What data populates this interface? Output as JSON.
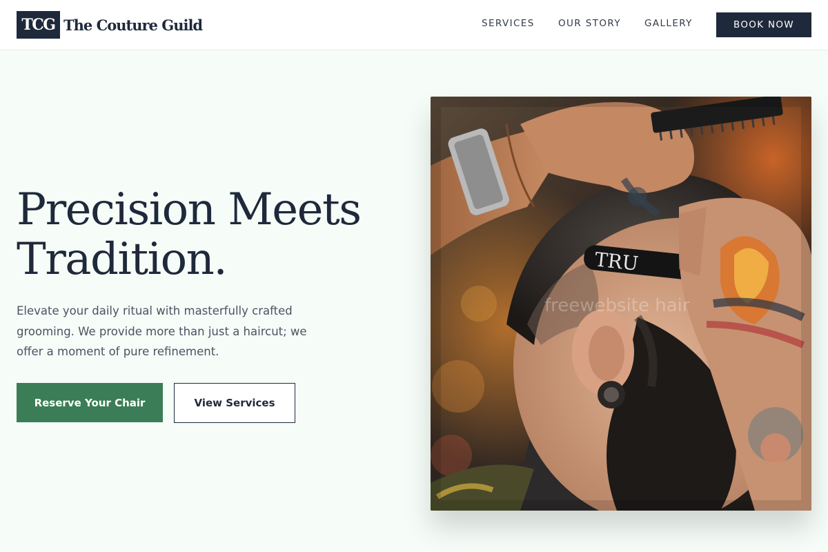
{
  "brand": {
    "mark": "TCG",
    "name": "The Couture Guild"
  },
  "nav": {
    "items": [
      {
        "label": "SERVICES"
      },
      {
        "label": "OUR STORY"
      },
      {
        "label": "GALLERY"
      }
    ],
    "cta_label": "BOOK NOW"
  },
  "hero": {
    "title_line1": "Precision Meets",
    "title_line2": "Tradition.",
    "description": "Elevate your daily ritual with masterfully crafted grooming. We provide more than just a haircut; we offer a moment of pure refinement.",
    "primary_button": "Reserve Your Chair",
    "secondary_button": "View Services",
    "photo": {
      "razor_text": "TRU",
      "watermark": "freewebsite hair"
    }
  },
  "colors": {
    "page_bg": "#f6fcf7",
    "navy": "#1e293b",
    "green": "#3b7d56",
    "body_text": "#4a5363"
  }
}
